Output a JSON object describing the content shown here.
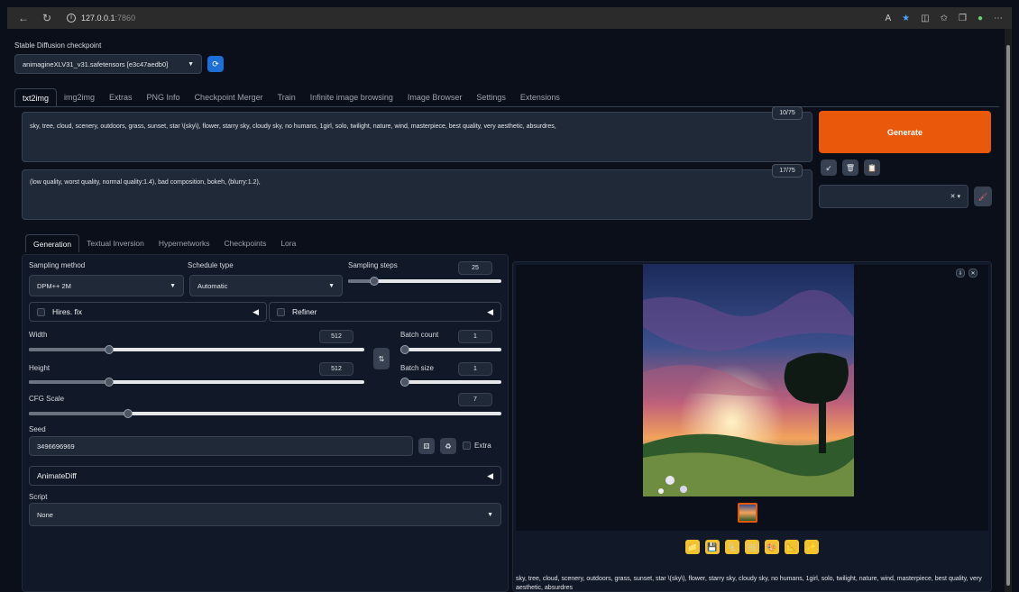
{
  "browser": {
    "url_host": "127.0.0.1",
    "url_port": ":7860"
  },
  "checkpoint": {
    "label": "Stable Diffusion checkpoint",
    "value": "animagineXLV31_v31.safetensors [e3c47aedb0]"
  },
  "main_tabs": [
    {
      "label": "txt2img"
    },
    {
      "label": "img2img"
    },
    {
      "label": "Extras"
    },
    {
      "label": "PNG Info"
    },
    {
      "label": "Checkpoint Merger"
    },
    {
      "label": "Train"
    },
    {
      "label": "Infinite image browsing"
    },
    {
      "label": "Image Browser"
    },
    {
      "label": "Settings"
    },
    {
      "label": "Extensions"
    }
  ],
  "prompt": {
    "text": "sky, tree, cloud, scenery, outdoors, grass, sunset, star \\(sky\\), flower, starry sky, cloudy sky, no humans, 1girl, solo, twilight, nature, wind, masterpiece, best quality, very aesthetic, absurdres,",
    "counter": "10/75"
  },
  "negative_prompt": {
    "text": "(low quality, worst quality, normal quality:1.4), bad composition, bokeh, (blurry:1.2),",
    "counter": "17/75"
  },
  "generate_label": "Generate",
  "sub_tabs": [
    {
      "label": "Generation"
    },
    {
      "label": "Textual Inversion"
    },
    {
      "label": "Hypernetworks"
    },
    {
      "label": "Checkpoints"
    },
    {
      "label": "Lora"
    }
  ],
  "sampling": {
    "method_label": "Sampling method",
    "method_value": "DPM++ 2M",
    "schedule_label": "Schedule type",
    "schedule_value": "Automatic",
    "steps_label": "Sampling steps",
    "steps_value": "25",
    "steps_fraction": 0.17
  },
  "hires": {
    "label": "Hires. fix"
  },
  "refiner": {
    "label": "Refiner"
  },
  "width": {
    "label": "Width",
    "value": "512",
    "fraction": 0.24
  },
  "height": {
    "label": "Height",
    "value": "512",
    "fraction": 0.24
  },
  "batch_count": {
    "label": "Batch count",
    "value": "1",
    "fraction": 0.0
  },
  "batch_size": {
    "label": "Batch size",
    "value": "1",
    "fraction": 0.0
  },
  "cfg": {
    "label": "CFG Scale",
    "value": "7",
    "fraction": 0.21
  },
  "seed": {
    "label": "Seed",
    "value": "3496696969",
    "extra_label": "Extra"
  },
  "animatediff": {
    "label": "AnimateDiff"
  },
  "script": {
    "label": "Script",
    "value": "None"
  },
  "output_caption": "sky, tree, cloud, scenery, outdoors, grass, sunset, star \\(sky\\), flower, starry sky, cloudy sky, no humans, 1girl, solo, twilight, nature, wind, masterpiece, best quality, very aesthetic, absurdres",
  "colors": {
    "accent": "#ea580c",
    "background": "#0b0f19"
  }
}
